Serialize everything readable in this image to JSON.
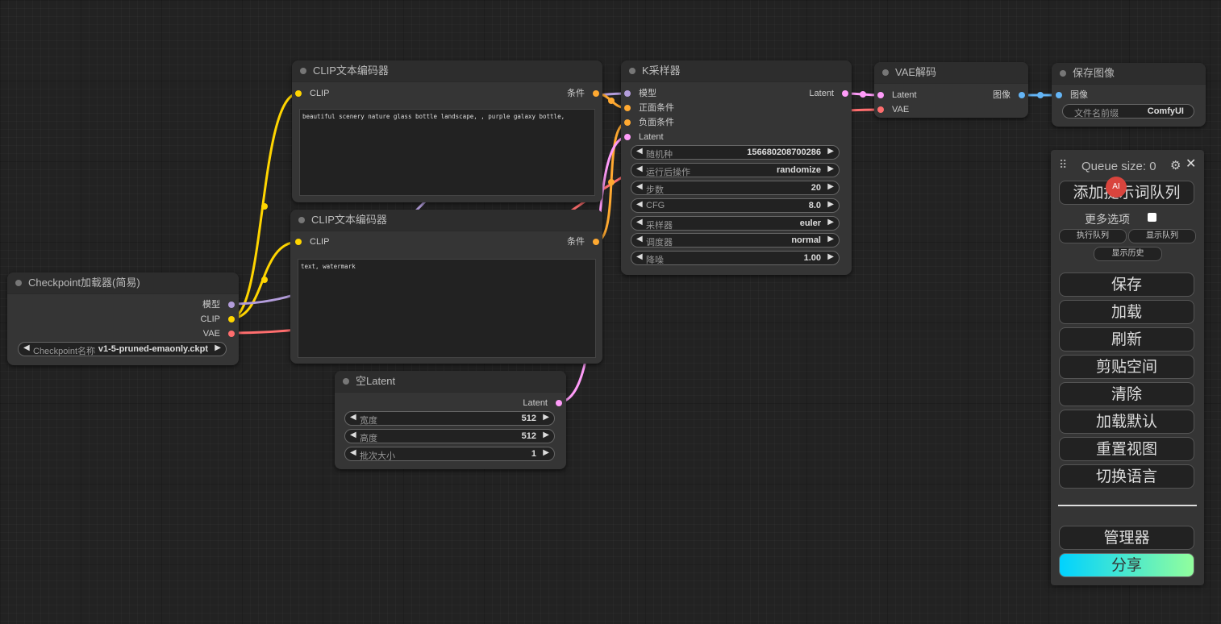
{
  "colors": {
    "clip": "#ffd500",
    "conditioning": "#ffa931",
    "model": "#b39ddb",
    "vae": "#ff6e6e",
    "latent": "#ff9cf9",
    "image": "#64b5f6"
  },
  "clip1": {
    "title": "CLIP文本编码器",
    "input_clip": "CLIP",
    "output": "条件",
    "text": "beautiful scenery nature glass bottle landscape, , purple galaxy bottle,"
  },
  "clip2": {
    "title": "CLIP文本编码器",
    "input_clip": "CLIP",
    "output": "条件",
    "text": "text, watermark"
  },
  "ksampler": {
    "title": "K采样器",
    "inputs": [
      "模型",
      "正面条件",
      "负面条件",
      "Latent"
    ],
    "output": "Latent",
    "widgets": [
      {
        "label": "随机种",
        "value": "156680208700286"
      },
      {
        "label": "运行后操作",
        "value": "randomize"
      },
      {
        "label": "步数",
        "value": "20"
      },
      {
        "label": "CFG",
        "value": "8.0"
      },
      {
        "label": "采样器",
        "value": "euler"
      },
      {
        "label": "调度器",
        "value": "normal"
      },
      {
        "label": "降噪",
        "value": "1.00"
      }
    ]
  },
  "vaedecode": {
    "title": "VAE解码",
    "inputs": [
      "Latent",
      "VAE"
    ],
    "output": "图像"
  },
  "saveimage": {
    "title": "保存图像",
    "input": "图像",
    "widget": {
      "label": "文件名前缀",
      "value": "ComfyUI"
    }
  },
  "checkpoint": {
    "title": "Checkpoint加载器(简易)",
    "outputs": [
      "模型",
      "CLIP",
      "VAE"
    ],
    "widget": {
      "label": "Checkpoint名称",
      "value": "v1-5-pruned-emaonly.ckpt"
    }
  },
  "emptylatent": {
    "title": "空Latent",
    "output": "Latent",
    "widgets": [
      {
        "label": "宽度",
        "value": "512"
      },
      {
        "label": "高度",
        "value": "512"
      },
      {
        "label": "批次大小",
        "value": "1"
      }
    ]
  },
  "panel": {
    "queue_size": "Queue size: 0",
    "add_prompt": "添加提示词队列",
    "more_options": "更多选项",
    "exec_queue": "执行队列",
    "show_queue": "显示队列",
    "show_history": "显示历史",
    "save": "保存",
    "load": "加载",
    "refresh": "刷新",
    "clipspace": "剪贴空间",
    "clear": "清除",
    "load_default": "加载默认",
    "reset_view": "重置视图",
    "switch_lang": "切换语言",
    "manager": "管理器",
    "share": "分享"
  }
}
